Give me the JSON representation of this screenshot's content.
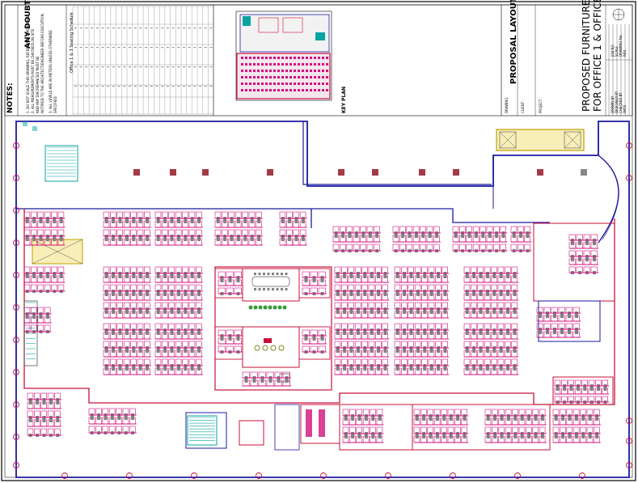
{
  "notes": {
    "heading": "NOTES:",
    "warning": "ANY DOUBTS PLEASE ASK",
    "lines": [
      "1. DO NOT SCALE THIS DRAWING, REFER ONLY DIMENSIONS.",
      "2. ALL MEASUREMENTS MUST BE CHECKED ON SITE",
      "   AND ANY DISCREPANCIES MUST BE",
      "   NOTIFIED TO THE ARCHITECT/ENGINEER BEFORE EXECUTION.",
      "3. ALL LEVELS ARE IN METERS UNLESS OTHERWISE",
      "   SPECIFIED."
    ]
  },
  "schedule": {
    "title": "Office 1 & 3 Seating Schedule"
  },
  "key_plan_label": "KEY PLAN",
  "title_block": {
    "drawing_label": "DRAWING",
    "drawing_title": "PROPOSAL LAYOUT",
    "client_label": "CLIENT :",
    "project_label": "PROJECT :",
    "project_title_1": "PROPOSED FURNITURE LAYOUT",
    "project_title_2": "FOR OFFICE 1 & OFFICE 3",
    "fields": [
      "DRAWN BY",
      "DESIGNED BY",
      "CHECKED BY",
      "DATE"
    ],
    "fields_right": [
      "JOB NO.",
      "SCALE",
      "DRAWING No.",
      "REV."
    ]
  },
  "colors": {
    "wall": "#1a1aa0",
    "partition": "#c8103a",
    "desk": "#d0117c",
    "chair": "#808080",
    "column": "#a43a44",
    "stair": "#0aa3a3",
    "core": "#d8c020",
    "glass": "#2fa0e0"
  }
}
